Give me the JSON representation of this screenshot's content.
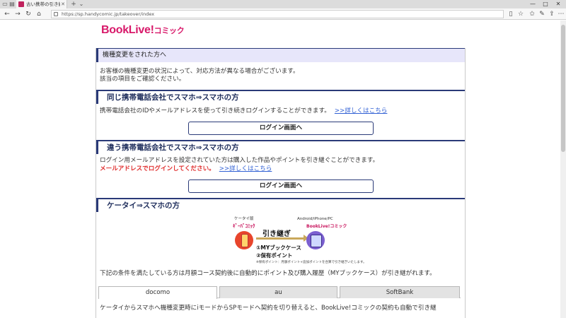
{
  "browser": {
    "tab_title": "古い携帯の引き継ぎ | 電",
    "url": "https://sp.handycomic.jp/takeover/index",
    "nav": {
      "back": "←",
      "forward": "→",
      "reload": "↻",
      "home": "⌂"
    },
    "win_controls": {
      "minimize": "—",
      "maximize": "□",
      "close": "✕"
    }
  },
  "logo": {
    "part1": "BookLive!",
    "part2": "コミック"
  },
  "intro": {
    "heading": "機種変更をされた方へ",
    "line1": "お客様の機種変更の状況によって、対応方法が異なる場合がございます。",
    "line2": "該当の項目をご確認ください。"
  },
  "section1": {
    "heading": "同じ携帯電話会社でスマホ⇒スマホの方",
    "text": "携帯電話会社のIDやメールアドレスを使って引き続きログインすることができます。",
    "link": ">>詳しくはこちら",
    "button": "ログイン画面へ"
  },
  "section2": {
    "heading": "違う携帯電話会社でスマホ⇒スマホの方",
    "text": "ログイン用メールアドレスを設定されていた方は購入した作品やポイントを引き継ぐことができます。",
    "red_text": "メールアドレスでログインしてください。",
    "link": ">>詳しくはこちら",
    "button": "ログイン画面へ"
  },
  "section3": {
    "heading": "ケータイ⇒スマホの方",
    "illustration": {
      "left_caption": "ケータイ版",
      "left_logo": "ｷﾞｰﾊﾞｺﾐｯｸ",
      "right_caption": "Android/iPhone/PC",
      "right_logo": "BookLive!コミック",
      "center": "引き継ぎ",
      "item1": "①MYブックケース",
      "item2": "②保有ポイント",
      "note": "※保有ポイント：月額ポイント+追加ポイントを合算で引き継ぎいたします。"
    },
    "text": "下記の条件を満たしている方は月額コース契約後に自動的にポイント及び購入履歴（MYブックケース）が引き継がれます。",
    "tabs": [
      "docomo",
      "au",
      "SoftBank"
    ],
    "active_tab": 0,
    "tab_content": "ケータイからスマホへ機種変更時にiモードからSPモードへ契約を切り替えると、BookLive!コミックの契約も自動で引き継"
  }
}
